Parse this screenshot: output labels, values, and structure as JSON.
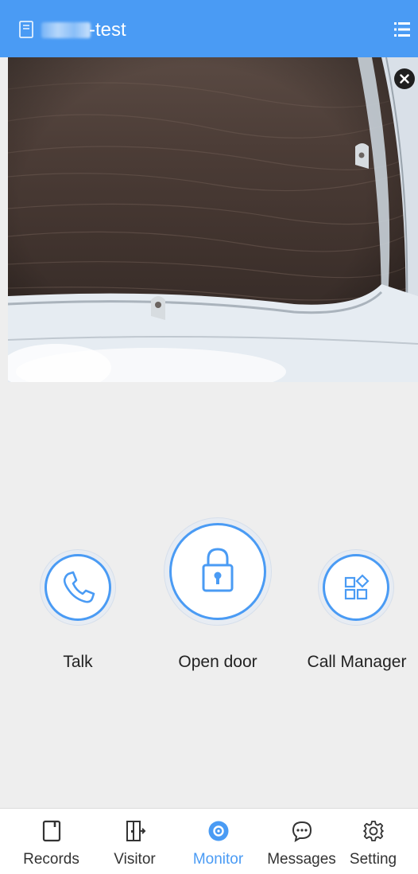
{
  "header": {
    "device_name": "-test",
    "device_icon": "device-panel-icon",
    "menu_icon": "list-menu-icon",
    "background_color": "#4a9bf4"
  },
  "video": {
    "close_icon": "close-icon",
    "close_label": "×"
  },
  "actions": [
    {
      "key": "talk",
      "label": "Talk",
      "icon": "phone-icon"
    },
    {
      "key": "open_door",
      "label": "Open door",
      "icon": "lock-icon"
    },
    {
      "key": "call_manager",
      "label": "Call Manager",
      "icon": "apps-icon"
    }
  ],
  "nav": {
    "items": [
      {
        "label": "Records",
        "icon": "records-icon",
        "active": false
      },
      {
        "label": "Visitor",
        "icon": "visitor-door-icon",
        "active": false
      },
      {
        "label": "Monitor",
        "icon": "monitor-icon",
        "active": true
      },
      {
        "label": "Messages",
        "icon": "messages-icon",
        "active": false
      },
      {
        "label": "Setting",
        "icon": "settings-gear-icon",
        "active": false
      }
    ]
  },
  "colors": {
    "accent": "#4a9bf4",
    "background": "#eeeeee"
  }
}
